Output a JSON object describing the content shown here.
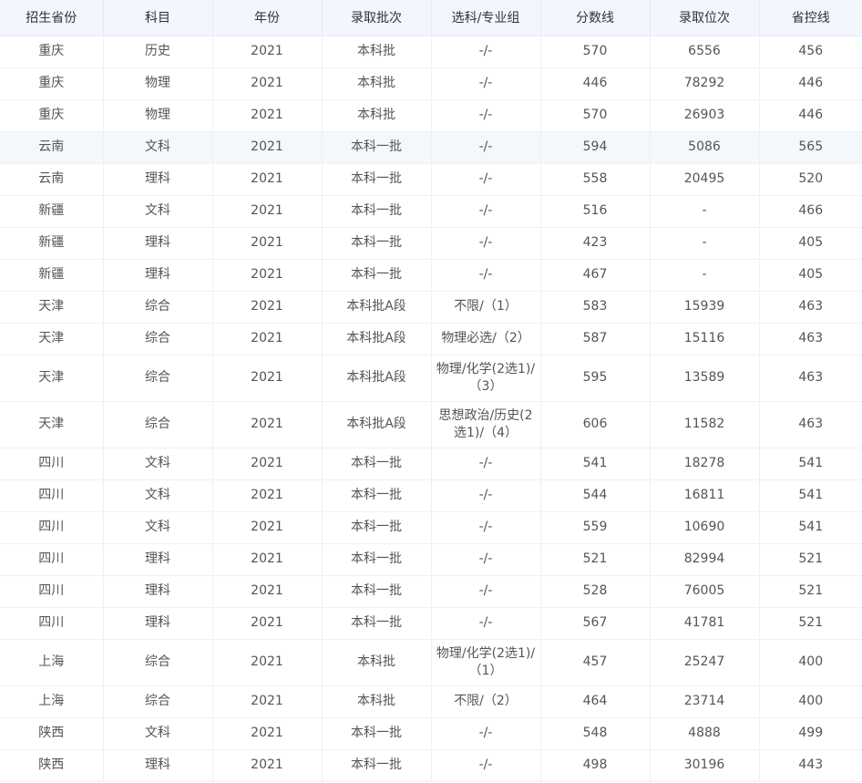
{
  "headers": [
    "招生省份",
    "科目",
    "年份",
    "录取批次",
    "选科/专业组",
    "分数线",
    "录取位次",
    "省控线"
  ],
  "rows": [
    [
      "重庆",
      "历史",
      "2021",
      "本科批",
      "-/-",
      "570",
      "6556",
      "456"
    ],
    [
      "重庆",
      "物理",
      "2021",
      "本科批",
      "-/-",
      "446",
      "78292",
      "446"
    ],
    [
      "重庆",
      "物理",
      "2021",
      "本科批",
      "-/-",
      "570",
      "26903",
      "446"
    ],
    [
      "云南",
      "文科",
      "2021",
      "本科一批",
      "-/-",
      "594",
      "5086",
      "565"
    ],
    [
      "云南",
      "理科",
      "2021",
      "本科一批",
      "-/-",
      "558",
      "20495",
      "520"
    ],
    [
      "新疆",
      "文科",
      "2021",
      "本科一批",
      "-/-",
      "516",
      "-",
      "466"
    ],
    [
      "新疆",
      "理科",
      "2021",
      "本科一批",
      "-/-",
      "423",
      "-",
      "405"
    ],
    [
      "新疆",
      "理科",
      "2021",
      "本科一批",
      "-/-",
      "467",
      "-",
      "405"
    ],
    [
      "天津",
      "综合",
      "2021",
      "本科批A段",
      "不限/（1）",
      "583",
      "15939",
      "463"
    ],
    [
      "天津",
      "综合",
      "2021",
      "本科批A段",
      "物理必选/（2）",
      "587",
      "15116",
      "463"
    ],
    [
      "天津",
      "综合",
      "2021",
      "本科批A段",
      "物理/化学(2选1)/（3）",
      "595",
      "13589",
      "463"
    ],
    [
      "天津",
      "综合",
      "2021",
      "本科批A段",
      "思想政治/历史(2选1)/（4）",
      "606",
      "11582",
      "463"
    ],
    [
      "四川",
      "文科",
      "2021",
      "本科一批",
      "-/-",
      "541",
      "18278",
      "541"
    ],
    [
      "四川",
      "文科",
      "2021",
      "本科一批",
      "-/-",
      "544",
      "16811",
      "541"
    ],
    [
      "四川",
      "文科",
      "2021",
      "本科一批",
      "-/-",
      "559",
      "10690",
      "541"
    ],
    [
      "四川",
      "理科",
      "2021",
      "本科一批",
      "-/-",
      "521",
      "82994",
      "521"
    ],
    [
      "四川",
      "理科",
      "2021",
      "本科一批",
      "-/-",
      "528",
      "76005",
      "521"
    ],
    [
      "四川",
      "理科",
      "2021",
      "本科一批",
      "-/-",
      "567",
      "41781",
      "521"
    ],
    [
      "上海",
      "综合",
      "2021",
      "本科批",
      "物理/化学(2选1)/（1）",
      "457",
      "25247",
      "400"
    ],
    [
      "上海",
      "综合",
      "2021",
      "本科批",
      "不限/（2）",
      "464",
      "23714",
      "400"
    ],
    [
      "陕西",
      "文科",
      "2021",
      "本科一批",
      "-/-",
      "548",
      "4888",
      "499"
    ],
    [
      "陕西",
      "理科",
      "2021",
      "本科一批",
      "-/-",
      "498",
      "30196",
      "443"
    ]
  ]
}
